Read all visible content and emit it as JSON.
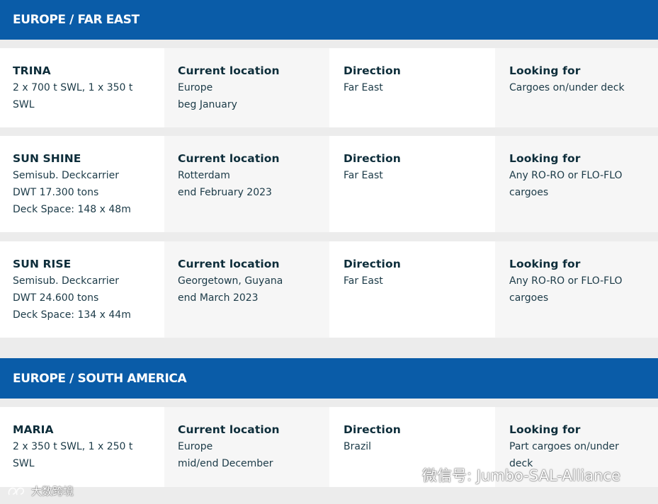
{
  "sections": [
    {
      "title": "EUROPE / FAR EAST"
    },
    {
      "title": "EUROPE / SOUTH AMERICA"
    }
  ],
  "labels": {
    "current_location": "Current location",
    "direction": "Direction",
    "looking_for": "Looking for"
  },
  "vessels": [
    {
      "name": "TRINA",
      "specs": [
        "2 x 700 t SWL, 1 x 350 t",
        "SWL"
      ],
      "location": [
        "Europe",
        "beg January"
      ],
      "direction": "Far East",
      "looking_for": [
        "Cargoes on/under deck"
      ]
    },
    {
      "name": "SUN SHINE",
      "specs": [
        "Semisub. Deckcarrier",
        "DWT 17.300 tons",
        "Deck Space: 148 x 48m"
      ],
      "location": [
        "Rotterdam",
        "end February 2023"
      ],
      "direction": "Far East",
      "looking_for": [
        "Any RO-RO or FLO-FLO",
        "cargoes"
      ]
    },
    {
      "name": "SUN RISE",
      "specs": [
        "Semisub. Deckcarrier",
        "DWT 24.600 tons",
        "Deck Space: 134 x 44m"
      ],
      "location": [
        "Georgetown, Guyana",
        "end March 2023"
      ],
      "direction": "Far East",
      "looking_for": [
        "Any RO-RO or FLO-FLO",
        "cargoes"
      ]
    },
    {
      "name": "MARIA",
      "specs": [
        "2 x 350 t SWL, 1 x 250 t",
        "SWL"
      ],
      "location": [
        "Europe",
        "mid/end December"
      ],
      "direction": "Brazil",
      "looking_for": [
        "Part cargoes on/under deck"
      ]
    }
  ],
  "watermarks": {
    "wechat": "微信号: Jumbo-SAL-Alliance",
    "brand": "大数跨境"
  }
}
